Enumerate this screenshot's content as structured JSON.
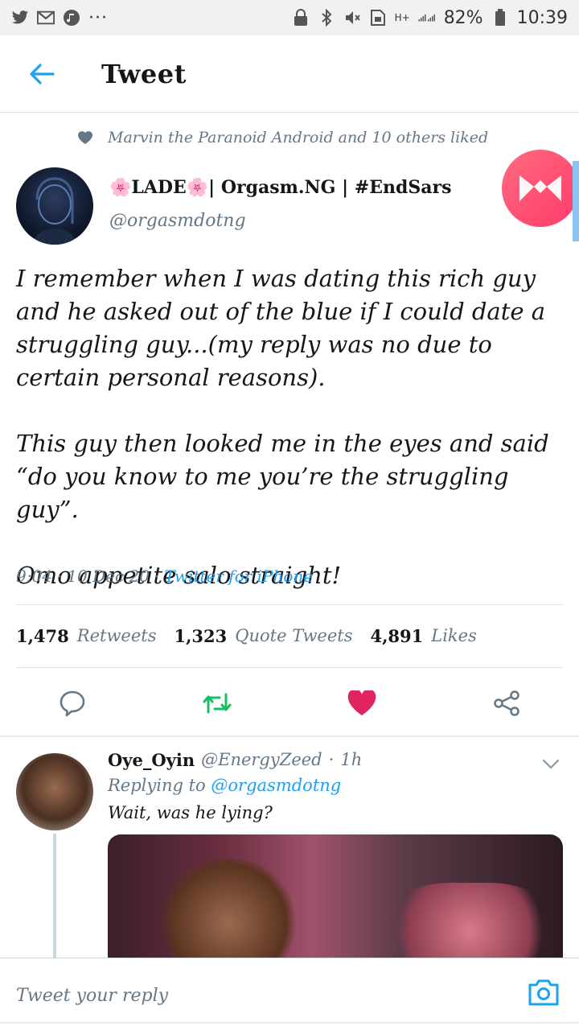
{
  "status_bar": {
    "battery_percent": "82%",
    "time": "10:39",
    "dots": "···",
    "network": "H+",
    "icons": [
      "twitter-icon",
      "gmail-icon",
      "music-icon",
      "lock-icon",
      "bluetooth-icon",
      "mute-icon",
      "sim-icon",
      "signal-icon",
      "battery-icon"
    ]
  },
  "header": {
    "title": "Tweet"
  },
  "social_context": {
    "text": "Marvin the Paranoid Android and 10 others liked"
  },
  "author": {
    "name": "🌸LADE🌸| Orgasm.NG | #EndSars",
    "handle": "@orgasmdotng"
  },
  "tweet": {
    "paragraphs": [
      "I remember when I was dating this rich guy and he asked out of the blue if I could date a struggling guy...(my reply was no due to certain personal reasons).",
      "This guy then looked me in the eyes and said “do you know to me you’re the struggling guy”.",
      "Omo appetite salo straight!"
    ],
    "time": "9:04",
    "date": "10 Dec 20",
    "source": "Twitter for iPhone",
    "sep1": "·",
    "sep2": "·"
  },
  "stats": {
    "retweets": {
      "count": "1,478",
      "label": "Retweets"
    },
    "quote_tweets": {
      "count": "1,323",
      "label": "Quote Tweets"
    },
    "likes": {
      "count": "4,891",
      "label": "Likes"
    }
  },
  "colors": {
    "accent": "#1da1f2",
    "retweet": "#17bf63",
    "like": "#e0245e",
    "muted": "#657786"
  },
  "reply": {
    "name": "Oye_Oyin",
    "handle": "@EnergyZeed",
    "sep": "·",
    "age": "1h",
    "replying_prefix": "Replying to",
    "replying_to": "@orgasmdotng",
    "text": "Wait, was he lying?"
  },
  "compose": {
    "placeholder": "Tweet your reply"
  }
}
